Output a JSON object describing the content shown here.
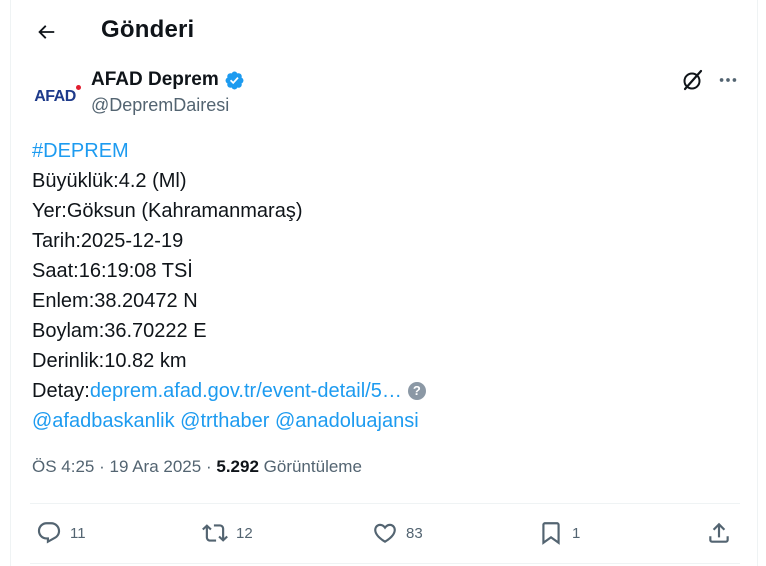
{
  "header": {
    "title": "Gönderi"
  },
  "author": {
    "avatar_text": "AFAD",
    "name": "AFAD Deprem",
    "handle": "@DepremDairesi",
    "verified_color": "#1d9bf0"
  },
  "tweet": {
    "hashtag": "#DEPREM",
    "lines": [
      "Büyüklük:4.2 (Ml)",
      "Yer:Göksun (Kahramanmaraş)",
      "Tarih:2025-12-19",
      "Saat:16:19:08 TSİ",
      "Enlem:38.20472 N",
      "Boylam:36.70222 E",
      "Derinlik:10.82 km"
    ],
    "detail_label": "Detay:",
    "detail_link": "deprem.afad.gov.tr/event-detail/5…",
    "mentions": "@afadbaskanlik @trthaber @anadoluajansi"
  },
  "meta": {
    "time": "ÖS 4:25",
    "separator": "·",
    "date": "19 Ara 2025",
    "views_count": "5.292",
    "views_label": "Görüntüleme"
  },
  "actions": {
    "replies": "11",
    "reposts": "12",
    "likes": "83",
    "bookmarks": "1"
  },
  "colors": {
    "link": "#1d9bf0",
    "secondary_text": "#536471",
    "border": "#eff3f4"
  }
}
